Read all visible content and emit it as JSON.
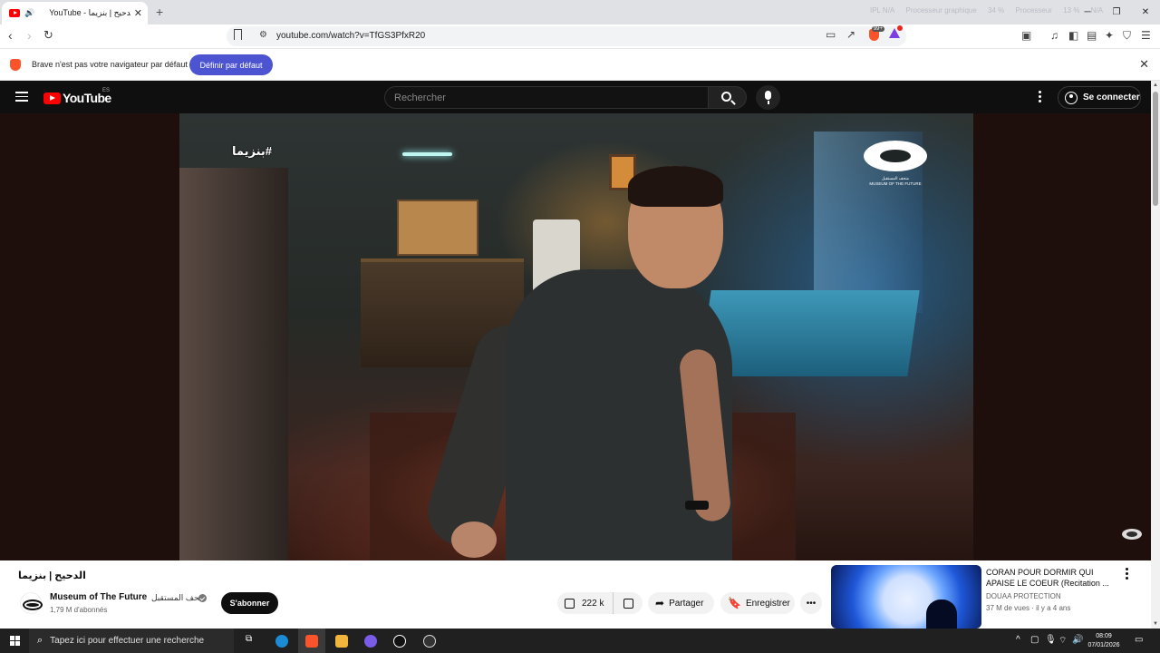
{
  "browser": {
    "tab_title": "YouTube - الدحيح | بنزيما",
    "url": "youtube.com/watch?v=TfGS3PfxR20",
    "shield_badge": "99+",
    "sysmon": [
      "IPL N/A",
      "Processeur graphique",
      "34 %",
      "Processeur",
      "13 %",
      "N/A"
    ]
  },
  "infobar": {
    "message": "Brave n'est pas votre navigateur par défaut",
    "button": "Définir par défaut"
  },
  "youtube": {
    "logo": "YouTube",
    "region": "ES",
    "search_placeholder": "Rechercher",
    "signin": "Se connecter",
    "video": {
      "overlay_hashtag": "#بنزيما",
      "museum_logo_text": "متحف المستقبل\nMUSEUM OF THE FUTURE",
      "title": "الدحيح | بنزيما",
      "channel": "Museum of The Future",
      "channel_arabic": "متحف المستقبل",
      "subscribers": "1,79 M d'abonnés",
      "subscribe": "S'abonner",
      "likes": "222 k",
      "share": "Partager",
      "save": "Enregistrer"
    },
    "recommended": {
      "title": "CORAN POUR DORMIR QUI APAISE LE COEUR (Recitation ...",
      "channel": "DOUAA PROTECTION",
      "meta": "37 M de vues · il y a 4 ans"
    }
  },
  "taskbar": {
    "search_placeholder": "Tapez ici pour effectuer une recherche",
    "time": "08:09",
    "date": "07/01/2026"
  }
}
